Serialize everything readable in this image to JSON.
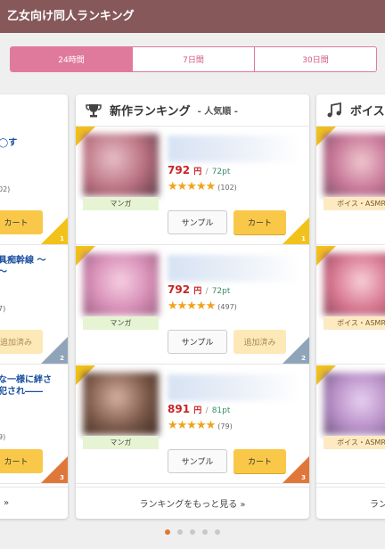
{
  "header": {
    "title": "乙女向け同人ランキング"
  },
  "tabs": [
    {
      "label": "24時間",
      "active": true
    },
    {
      "label": "7日間",
      "active": false
    },
    {
      "label": "30日間",
      "active": false
    }
  ],
  "left_card": {
    "items": [
      {
        "title_line1": "◯す",
        "small": "02)",
        "button": "カート"
      },
      {
        "title_line1": "具痴幹線 ～",
        "title_line2": "～",
        "small": "7)",
        "button": "追加済み"
      },
      {
        "title_line1": "な一様に絆さ",
        "title_line2": "犯され――",
        "small": "9)",
        "button": "カート"
      }
    ],
    "more_arrow": "»"
  },
  "main_card": {
    "title": "新作ランキング",
    "subtitle": "- 人気順 -",
    "items": [
      {
        "genre": "マンガ",
        "price": "792",
        "yen": "円",
        "pt": "72pt",
        "stars": "★★★★★",
        "reviews": "(102)",
        "sample": "サンプル",
        "cart": "カート",
        "rank": "1",
        "thumb": "#b86f7e"
      },
      {
        "genre": "マンガ",
        "price": "792",
        "yen": "円",
        "pt": "72pt",
        "stars": "★★★★★",
        "reviews": "(497)",
        "sample": "サンプル",
        "cart": "追加済み",
        "rank": "2",
        "thumb": "#d890b8"
      },
      {
        "genre": "マンガ",
        "price": "891",
        "yen": "円",
        "pt": "81pt",
        "stars": "★★★★★",
        "reviews": "(79)",
        "sample": "サンプル",
        "cart": "カート",
        "rank": "3",
        "thumb": "#7a5848"
      }
    ],
    "more": "ランキングをもっと見る »"
  },
  "right_card": {
    "title": "ボイス",
    "genre": "ボイス・ASMR",
    "more": "ラン"
  },
  "pagination": {
    "count": 5,
    "active": 0
  },
  "colors": {
    "accent": "#e07a9d",
    "header": "#86585a",
    "cart": "#f9c849"
  }
}
